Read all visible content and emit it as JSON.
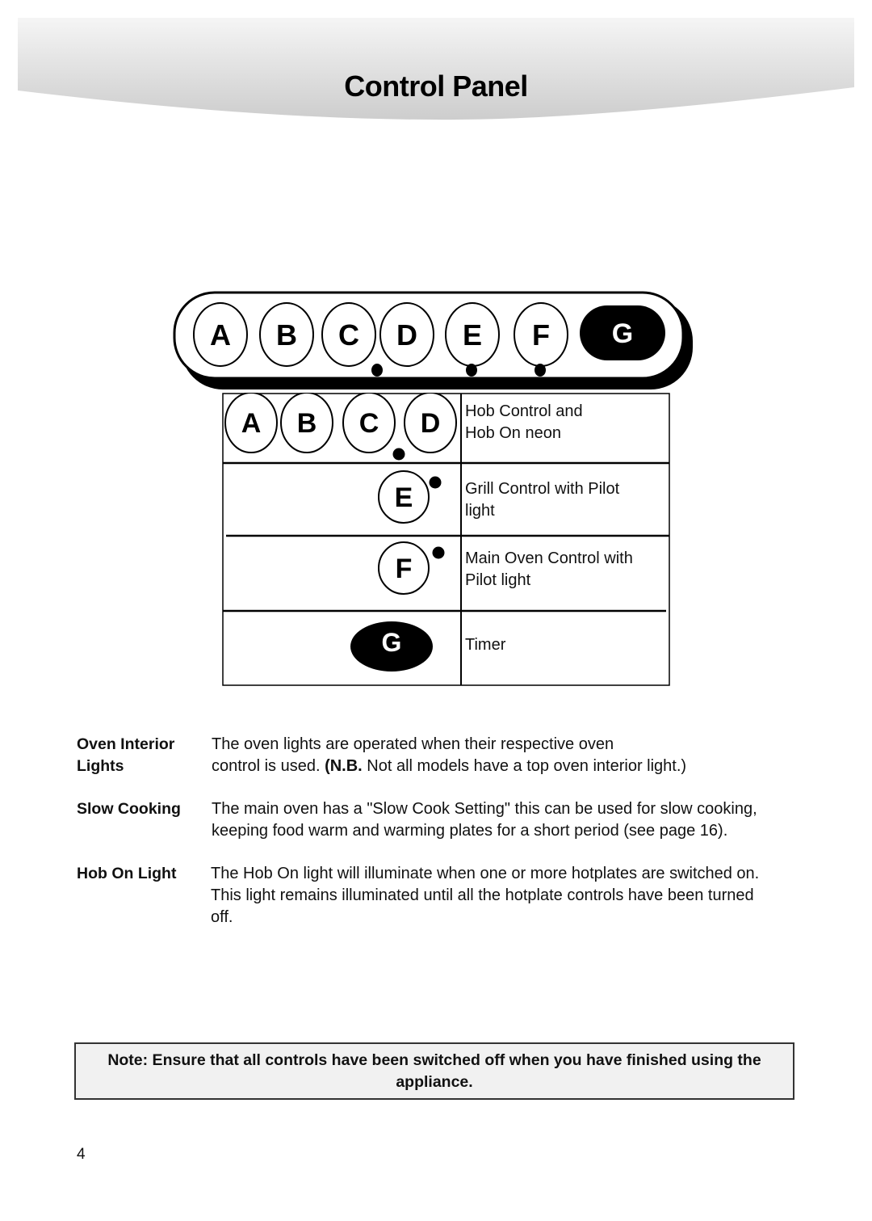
{
  "header": {
    "title": "Control Panel"
  },
  "panel": {
    "knobs": [
      {
        "letter": "A",
        "style": "outline",
        "has_indicator": false
      },
      {
        "letter": "B",
        "style": "outline",
        "has_indicator": false
      },
      {
        "letter": "C",
        "style": "outline",
        "has_indicator": true
      },
      {
        "letter": "D",
        "style": "outline",
        "has_indicator": false
      },
      {
        "letter": "E",
        "style": "outline",
        "has_indicator": true
      },
      {
        "letter": "F",
        "style": "outline",
        "has_indicator": true
      },
      {
        "letter": "G",
        "style": "filled",
        "has_indicator": false
      }
    ]
  },
  "legend": {
    "rows": [
      {
        "letters": [
          "A",
          "B",
          "C",
          "D"
        ],
        "description_lines": [
          "Hob Control and",
          "Hob On neon"
        ]
      },
      {
        "letters": [
          "E"
        ],
        "description_lines": [
          "Grill Control with Pilot",
          "light"
        ]
      },
      {
        "letters": [
          "F"
        ],
        "description_lines": [
          "Main Oven Control with",
          "Pilot light"
        ]
      },
      {
        "letters": [
          "G"
        ],
        "description_lines": [
          "Timer"
        ]
      }
    ]
  },
  "sections": [
    {
      "term_lines": [
        "Oven Interior",
        "Lights"
      ],
      "desc_line1": "The oven lights are operated when their respective oven",
      "desc_line2_pre": "control is used. ",
      "desc_line2_bold": "(N.B.",
      "desc_line2_post": " Not all models have a top oven interior light.)"
    },
    {
      "term_lines": [
        "Slow Cooking"
      ],
      "desc_lines": [
        "The main oven has a \"Slow Cook Setting\" this can be used for slow cooking,",
        "keeping food warm and warming plates for a short period (see page 16)."
      ]
    },
    {
      "term_lines": [
        "Hob On Light"
      ],
      "desc_lines": [
        "The Hob On light will illuminate when one or more hotplates are switched on.",
        "This light remains illuminated until all the hotplate controls have been turned",
        "off."
      ]
    }
  ],
  "note": {
    "line1": "Note:  Ensure that all controls have been switched off when you have  finished using the",
    "line2": "appliance."
  },
  "page_number": "4",
  "colors": {
    "banner_top": "#f4f4f4",
    "banner_bottom": "#cfcfcf",
    "note_bg": "#f1f1f1",
    "ink": "#000000"
  }
}
